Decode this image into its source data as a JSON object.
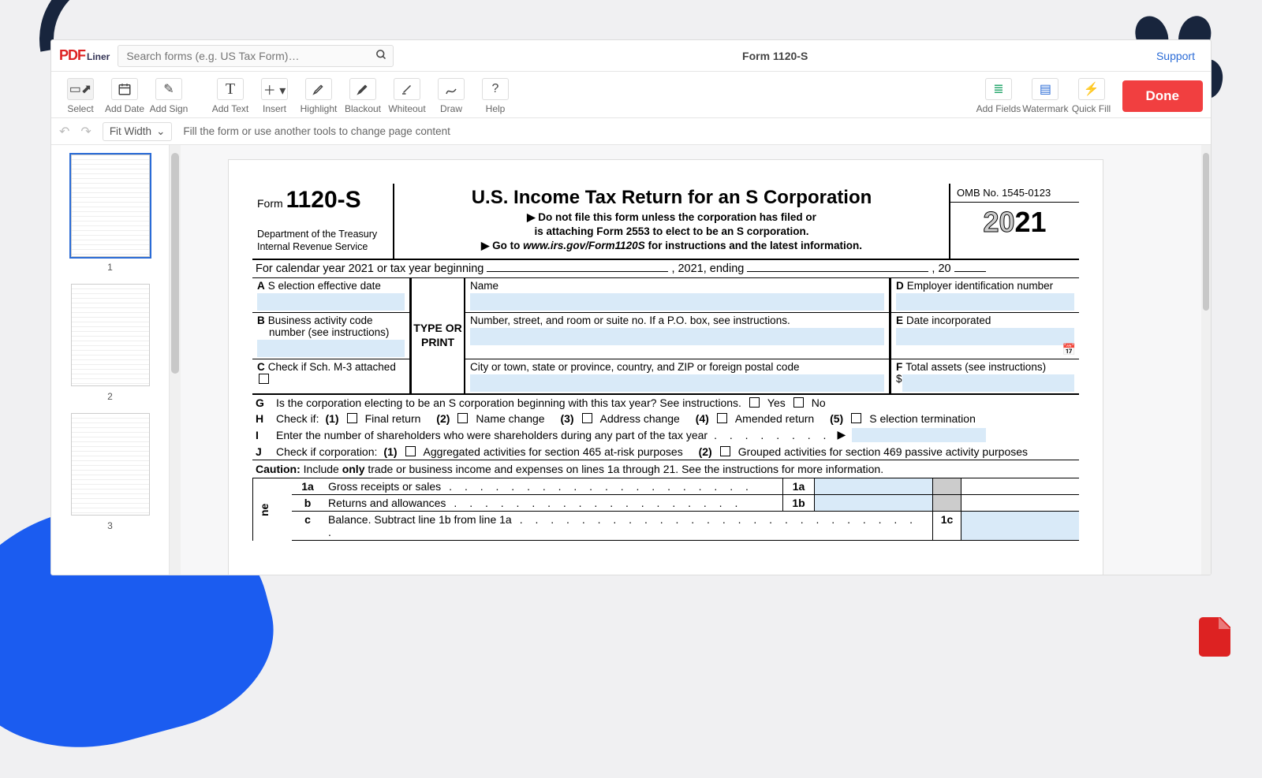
{
  "header": {
    "logo_pdf": "PDF",
    "logo_liner": "Liner",
    "search_placeholder": "Search forms (e.g. US Tax Form)…",
    "doc_title": "Form 1120-S",
    "support": "Support"
  },
  "toolbar": {
    "select": "Select",
    "add_date": "Add Date",
    "add_sign": "Add Sign",
    "add_text": "Add Text",
    "insert": "Insert",
    "highlight": "Highlight",
    "blackout": "Blackout",
    "whiteout": "Whiteout",
    "draw": "Draw",
    "help": "Help",
    "add_fields": "Add Fields",
    "watermark": "Watermark",
    "quick_fill": "Quick Fill",
    "done": "Done"
  },
  "subbar": {
    "fit": "Fit Width",
    "hint": "Fill the form or use another tools to change page content"
  },
  "thumbs": {
    "p1": "1",
    "p2": "2",
    "p3": "3"
  },
  "form": {
    "form_label": "Form",
    "form_number": "1120-S",
    "dept1": "Department of the Treasury",
    "dept2": "Internal Revenue Service",
    "title": "U.S. Income Tax Return for an S Corporation",
    "note1": "Do not file this form unless the corporation has filed or",
    "note2": "is attaching Form 2553 to elect to be an S corporation.",
    "note3_a": "Go to ",
    "note3_b": "www.irs.gov/Form1120S",
    "note3_c": " for instructions and the latest information.",
    "omb": "OMB No. 1545-0123",
    "year_grey": "20",
    "year_bold": "21",
    "cal_a": "For calendar year 2021 or tax year beginning",
    "cal_b": ", 2021, ending",
    "cal_c": ", 20",
    "A": "S election effective date",
    "B1": "Business activity code",
    "B2": "number (see instructions)",
    "C": "Check if Sch. M-3 attached",
    "type_or_print": "TYPE OR PRINT",
    "name": "Name",
    "addr1": "Number, street, and room or suite no. If a P.O. box, see instructions.",
    "addr2": "City or town, state or province, country, and ZIP or foreign postal code",
    "D": "Employer identification number",
    "E": "Date incorporated",
    "F": "Total assets (see instructions)",
    "F_prefix": "$",
    "G": "Is the corporation electing to be an S corporation beginning with this tax year? See instructions.",
    "G_yes": "Yes",
    "G_no": "No",
    "H": "Check if:",
    "H1": "Final return",
    "H2": "Name change",
    "H3": "Address change",
    "H4": "Amended return",
    "H5": "S election termination",
    "Hn1": "(1)",
    "Hn2": "(2)",
    "Hn3": "(3)",
    "Hn4": "(4)",
    "Hn5": "(5)",
    "I": "Enter the number of shareholders who were shareholders during any part of the tax year",
    "J": "Check if corporation:",
    "J1": "Aggregated activities for section 465 at-risk purposes",
    "J2": "Grouped activities for section 469 passive activity purposes",
    "Jn1": "(1)",
    "Jn2": "(2)",
    "caution_b": "Caution:",
    "caution_t1": " Include ",
    "caution_only": "only",
    "caution_t2": " trade or business income and expenses on lines 1a through 21. See the instructions for more information.",
    "inc_side": "ne",
    "r1a_n": "1a",
    "r1a_t": "Gross receipts or sales",
    "r1b_n": "b",
    "r1b_t": "Returns and allowances",
    "r1c_n": "c",
    "r1c_t": "Balance. Subtract line 1b from line 1a",
    "col_1a": "1a",
    "col_1b": "1b",
    "col_1c": "1c"
  }
}
